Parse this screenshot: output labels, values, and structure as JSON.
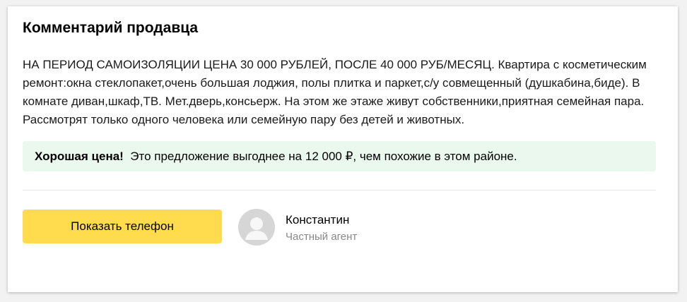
{
  "seller_comment": {
    "title": "Комментарий продавца",
    "text": "НА ПЕРИОД САМОИЗОЛЯЦИИ ЦЕНА 30 000 РУБЛЕЙ, ПОСЛЕ 40 000 РУБ/МЕСЯЦ. Квартира с косметическим ремонт:окна стеклопакет,очень большая лоджия, полы плитка и паркет,с/у совмещенный (душкабина,биде). В комнате диван,шкаф,ТВ. Мет.дверь,консьерж. На этом же этаже живут собственники,приятная семейная пара. Рассмотрят только одного человека или семейную пару без детей и животных."
  },
  "price_note": {
    "label": "Хорошая цена!",
    "text": "Это предложение выгоднее на 12 000 ₽, чем похожие в этом районе.",
    "background_color": "#eaf8ee"
  },
  "contact": {
    "show_phone_label": "Показать телефон",
    "button_color": "#ffdb4d",
    "avatar_icon": "user-avatar-placeholder-icon",
    "name": "Константин",
    "role": "Частный агент"
  }
}
